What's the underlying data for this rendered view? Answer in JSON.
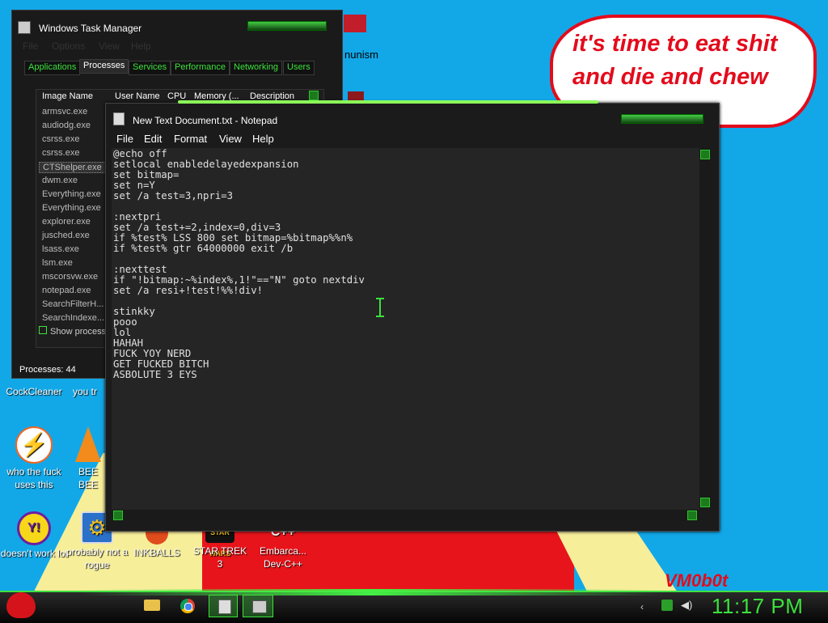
{
  "wallpaper": {
    "speech_lines": [
      "it's time to eat shit",
      "and die and chew"
    ],
    "signature": "VM0b0t",
    "partial_text": "nunism"
  },
  "desktop_icons": [
    {
      "label": "CockCleaner",
      "icon": "app-icon"
    },
    {
      "label": "you tr",
      "icon": "app-icon"
    },
    {
      "label": "who the fuck uses this",
      "icon": "avast-icon"
    },
    {
      "label": "BEE BEE",
      "icon": "vlc-cone-icon"
    },
    {
      "label": "doesn't work lol",
      "icon": "yahoo-messenger-icon"
    },
    {
      "label": "probably not a rogue",
      "icon": "setup-icon"
    },
    {
      "label": "INKBALLS",
      "icon": "inkball-icon"
    },
    {
      "label": "STAR TREK 3",
      "icon": "star-wars-icon"
    },
    {
      "label": "Embarca... Dev-C++",
      "icon": "cpp-icon"
    }
  ],
  "task_manager": {
    "title": "Windows Task Manager",
    "menu": [
      "File",
      "Options",
      "View",
      "Help"
    ],
    "tabs": [
      "Applications",
      "Processes",
      "Services",
      "Performance",
      "Networking",
      "Users"
    ],
    "active_tab": "Processes",
    "columns": [
      "Image Name",
      "User Name",
      "CPU",
      "Memory (...",
      "Description"
    ],
    "processes": [
      "armsvc.exe",
      "audiodg.exe",
      "csrss.exe",
      "csrss.exe",
      "CTShelper.exe",
      "dwm.exe",
      "Everything.exe",
      "Everything.exe",
      "explorer.exe",
      "jusched.exe",
      "lsass.exe",
      "lsm.exe",
      "mscorsvw.exe",
      "notepad.exe",
      "SearchFilterH...",
      "SearchIndexe..."
    ],
    "show_all": "Show process",
    "status": "Processes: 44"
  },
  "notepad": {
    "title": "New Text Document.txt - Notepad",
    "menu": [
      "File",
      "Edit",
      "Format",
      "View",
      "Help"
    ],
    "content": "@echo off\nsetlocal enabledelayedexpansion\nset bitmap=\nset n=Y\nset /a test=3,npri=3\n\n:nextpri\nset /a test+=2,index=0,div=3\nif %test% LSS 800 set bitmap=%bitmap%%n%\nif %test% gtr 64000000 exit /b\n\n:nexttest\nif \"!bitmap:~%index%,1!\"==\"N\" goto nextdiv\nset /a resi+!test!%%!div!\n\nstinkky\npooo\nlol\nHAHAH\nFUCK YOY NERD\nGET FUCKED BITCH\nASBOLUTE 3 EYS"
  },
  "taskbar": {
    "clock": "11:17 PM",
    "items": [
      "folder-icon",
      "chrome-icon",
      "notepad-icon",
      "task-manager-icon"
    ],
    "accent": "#3be23b"
  }
}
